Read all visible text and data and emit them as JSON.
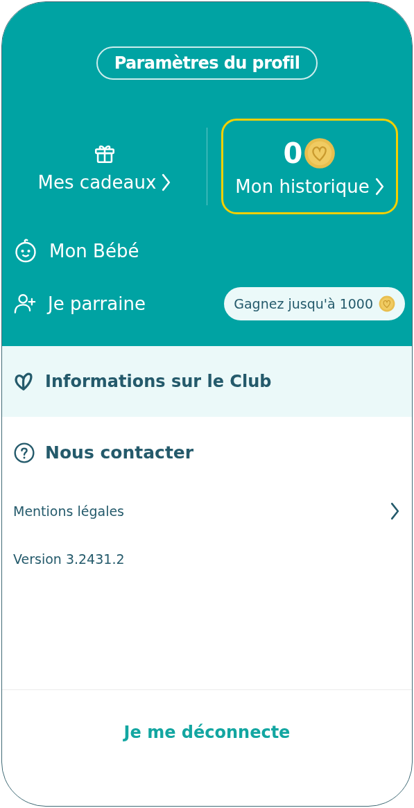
{
  "profile_button": {
    "label": "Paramètres du profil"
  },
  "summary": [
    {
      "kind": "gifts",
      "label": "Mes cadeaux",
      "highlighted": false
    },
    {
      "kind": "history",
      "points": "0",
      "label": "Mon historique",
      "highlighted": true
    }
  ],
  "menu": [
    {
      "kind": "baby",
      "label": "Mon Bébé"
    },
    {
      "kind": "referral",
      "label": "Je parraine",
      "badge": "Gagnez jusqu'à 1000"
    }
  ],
  "club_info": {
    "label": "Informations sur le Club"
  },
  "contact": {
    "label": "Nous contacter"
  },
  "legal": {
    "label": "Mentions légales"
  },
  "version": "Version 3.2431.2",
  "logout": {
    "label": "Je me déconnecte"
  }
}
